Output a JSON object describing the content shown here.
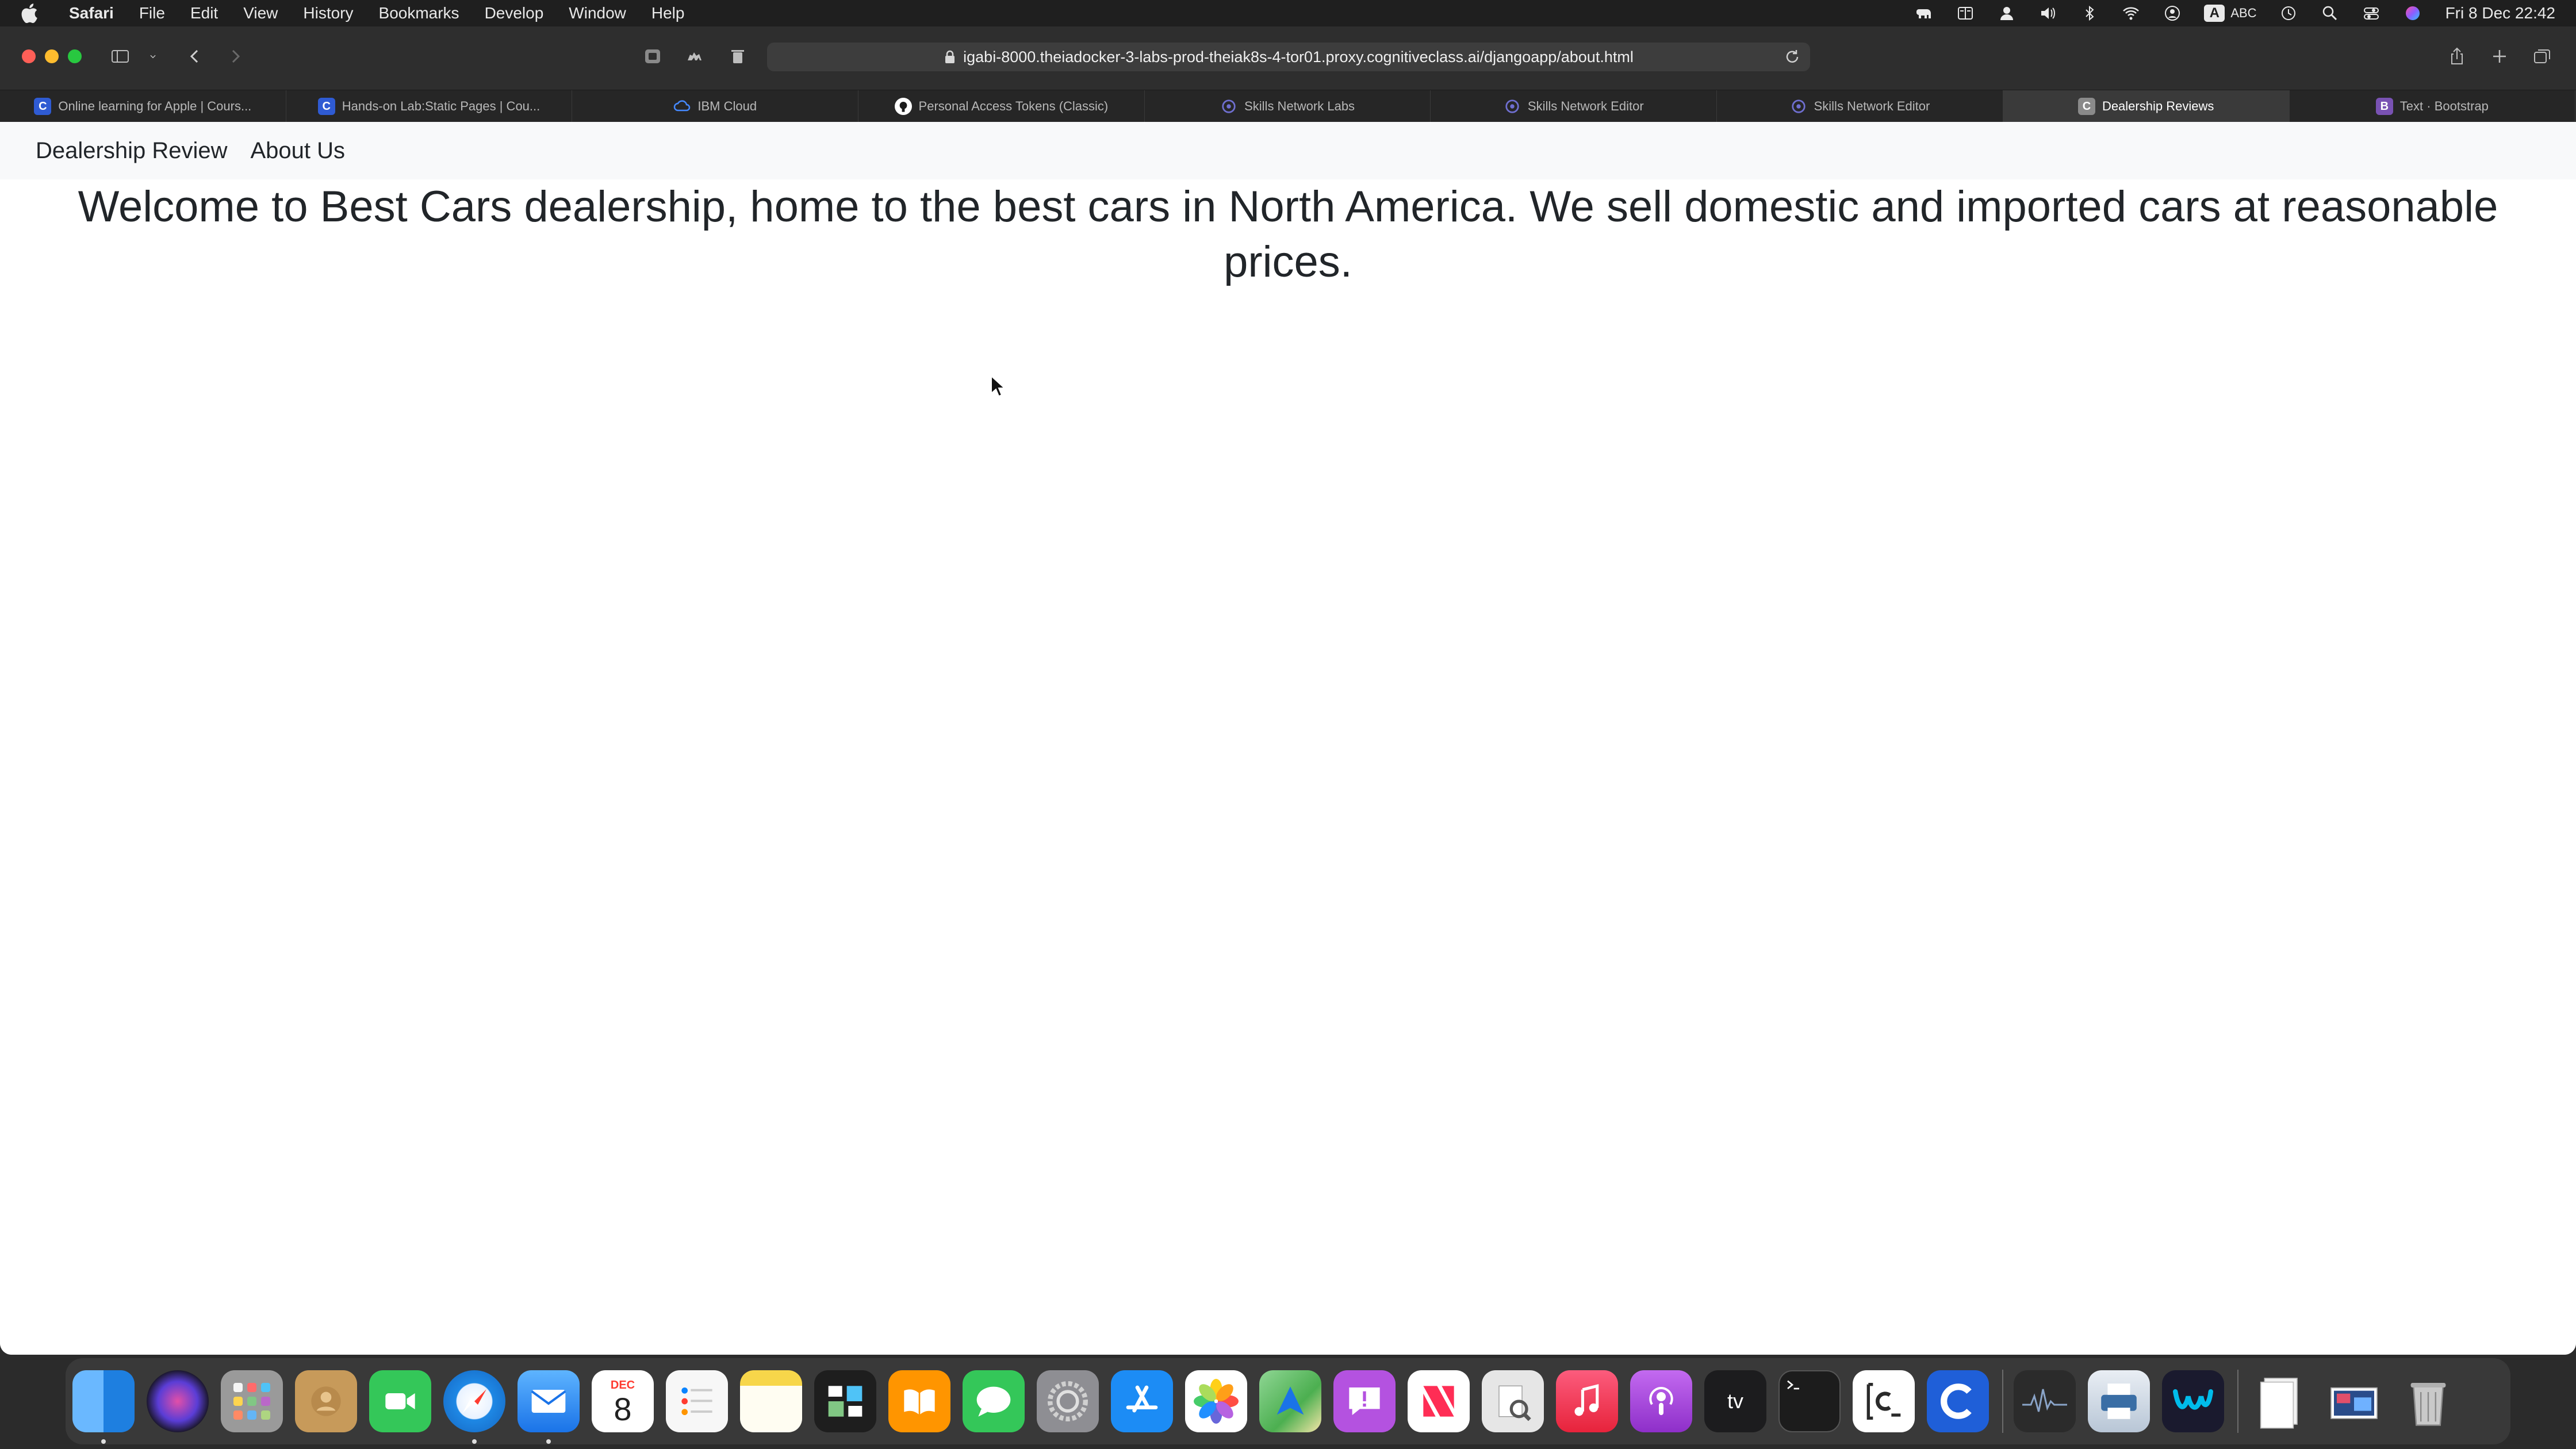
{
  "menubar": {
    "app_name": "Safari",
    "items": [
      "File",
      "Edit",
      "View",
      "History",
      "Bookmarks",
      "Develop",
      "Window",
      "Help"
    ],
    "input_badge": "A",
    "input_label": "ABC",
    "clock": "Fri 8 Dec  22:42"
  },
  "browser": {
    "url": "igabi-8000.theiadocker-3-labs-prod-theiak8s-4-tor01.proxy.cognitiveclass.ai/djangoapp/about.html",
    "tabs": [
      {
        "label": "Online learning for Apple | Cours...",
        "icon": "C",
        "color": "#2f5bd3"
      },
      {
        "label": "Hands-on Lab:Static Pages | Cou...",
        "icon": "C",
        "color": "#2f5bd3"
      },
      {
        "label": "IBM Cloud",
        "icon": "cloud",
        "color": "#4589ff"
      },
      {
        "label": "Personal Access Tokens (Classic)",
        "icon": "github",
        "color": "#ffffff"
      },
      {
        "label": "Skills Network Labs",
        "icon": "sn",
        "color": "#6f6fd0"
      },
      {
        "label": "Skills Network Editor",
        "icon": "sn",
        "color": "#6f6fd0"
      },
      {
        "label": "Skills Network Editor",
        "icon": "sn",
        "color": "#6f6fd0"
      },
      {
        "label": "Dealership Reviews",
        "icon": "C",
        "color": "#8a8a8a"
      },
      {
        "label": "Text · Bootstrap",
        "icon": "B",
        "color": "#7952b3"
      }
    ]
  },
  "page": {
    "nav_brand": "Dealership Review",
    "nav_about": "About Us",
    "welcome": "Welcome to Best Cars dealership, home to the best cars in North America. We sell domestic and imported cars at reasonable prices."
  },
  "dock": {
    "calendar_month": "DEC",
    "calendar_day": "8",
    "apps": [
      {
        "name": "finder",
        "color": "#3b8ee8"
      },
      {
        "name": "siri",
        "color": "#3b2d7a"
      },
      {
        "name": "launchpad",
        "color": "#8d8d8d"
      },
      {
        "name": "contacts",
        "color": "#c79a5a"
      },
      {
        "name": "facetime",
        "color": "#34c759"
      },
      {
        "name": "safari",
        "color": "#1e88e5"
      },
      {
        "name": "mail",
        "color": "#2d8ef0"
      },
      {
        "name": "calendar",
        "color": "#ffffff"
      },
      {
        "name": "reminders",
        "color": "#f5f5f5"
      },
      {
        "name": "notes",
        "color": "#f7d64a"
      },
      {
        "name": "freeform",
        "color": "#1e1e1e"
      },
      {
        "name": "books",
        "color": "#ff9500"
      },
      {
        "name": "messages",
        "color": "#34c759"
      },
      {
        "name": "system-settings",
        "color": "#8e8e93"
      },
      {
        "name": "app-store",
        "color": "#1c8cf5"
      },
      {
        "name": "photos",
        "color": "#ffffff"
      },
      {
        "name": "maps",
        "color": "#5fc46b"
      },
      {
        "name": "feedback",
        "color": "#b452e0"
      },
      {
        "name": "news",
        "color": "#ffffff"
      },
      {
        "name": "preview",
        "color": "#dcdcdc"
      },
      {
        "name": "music",
        "color": "#fa3c4c"
      },
      {
        "name": "podcasts",
        "color": "#9b3fd6"
      },
      {
        "name": "apple-tv",
        "color": "#1c1c1e"
      },
      {
        "name": "terminal",
        "color": "#1c1c1c"
      },
      {
        "name": "coursera-editor",
        "color": "#ffffff"
      },
      {
        "name": "coursera",
        "color": "#1f5fd8"
      },
      {
        "name": "activity-monitor",
        "color": "#2b2b2b"
      },
      {
        "name": "printer",
        "color": "#dfe6ee"
      },
      {
        "name": "webex",
        "color": "#1a1a2e"
      },
      {
        "name": "documents",
        "color": "#e8e8e8"
      },
      {
        "name": "screenshot",
        "color": "#2a4c8a"
      },
      {
        "name": "trash",
        "color": "#a8a8a8"
      }
    ],
    "apple_tv_label": "tv"
  }
}
